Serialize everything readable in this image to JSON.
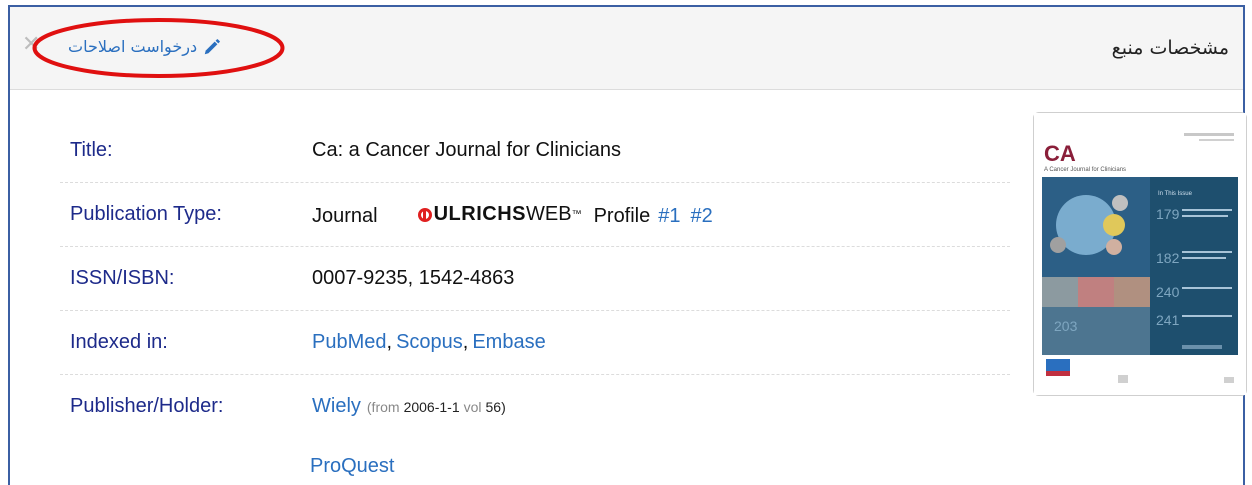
{
  "header": {
    "title": "مشخصات منبع",
    "edit_request": "درخواست اصلاحات",
    "close_symbol": "✕"
  },
  "details": {
    "title_label": "Title:",
    "title_value": "Ca: a Cancer Journal for Clinicians",
    "pubtype_label": "Publication Type:",
    "pubtype_value": "Journal",
    "ulrichs_bold": "ULRICHS",
    "ulrichs_web": "WEB",
    "ulrichs_tm": "™",
    "profile_label": "Profile",
    "profile_links": [
      "#1",
      "#2"
    ],
    "issn_label": "ISSN/ISBN:",
    "issn_value": "0007-9235, 1542-4863",
    "indexed_label": "Indexed in:",
    "indexed_links": [
      "PubMed",
      "Scopus",
      "Embase"
    ],
    "publisher_label": "Publisher/Holder:",
    "publisher_1": "Wiely",
    "publisher_1_from_open": "(from",
    "publisher_1_date": "2006-1-1",
    "publisher_1_vol_word": "vol",
    "publisher_1_vol_close": "56)",
    "publisher_2": "ProQuest"
  },
  "cover": {
    "logo": "CA",
    "subtitle": "A Cancer Journal for Clinicians",
    "issue_numbers": [
      "179",
      "182",
      "240",
      "241",
      "203"
    ],
    "colors": {
      "panel": "#1e4f6e",
      "logo": "#8a1f3a"
    }
  },
  "colors": {
    "label": "#1d2a8a",
    "link": "#2a6fbf",
    "border": "#3b5fa3",
    "annotation": "#e01010"
  }
}
